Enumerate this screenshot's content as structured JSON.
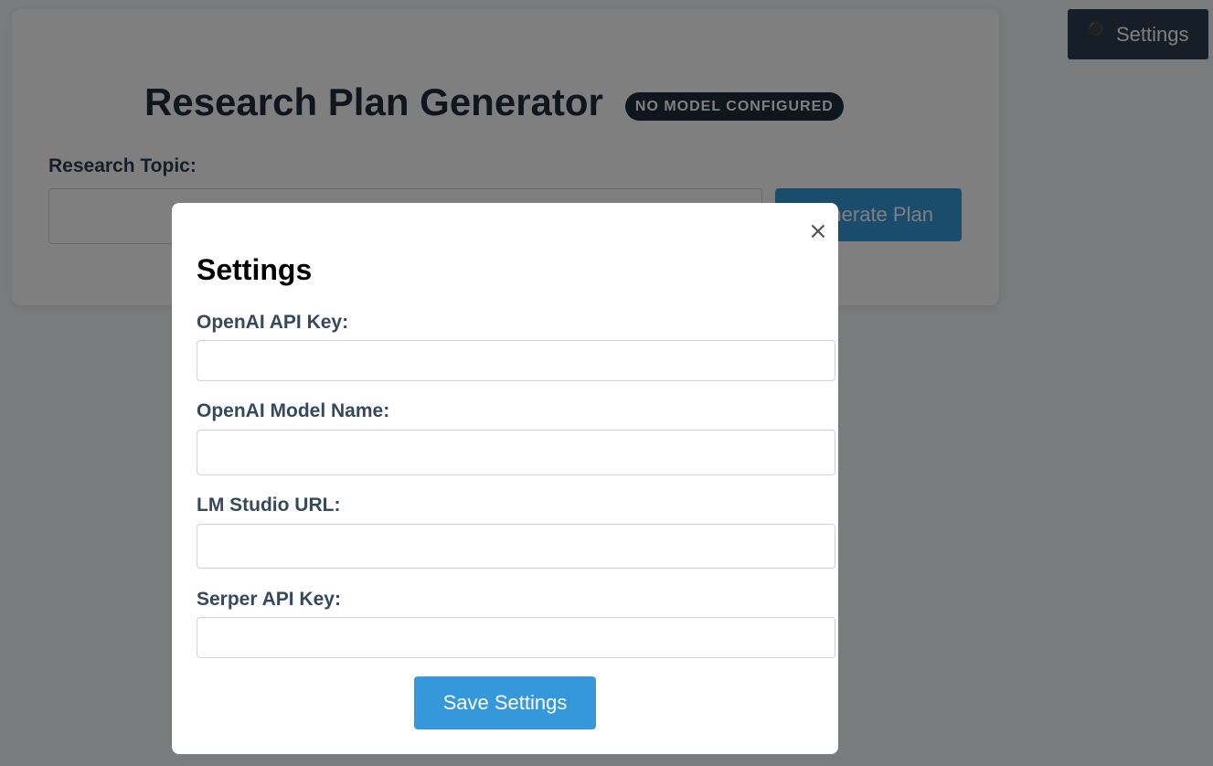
{
  "header": {
    "settings_button_label": "Settings",
    "settings_icon": "gear-icon"
  },
  "main": {
    "title": "Research Plan Generator",
    "model_status_badge": "NO MODEL CONFIGURED",
    "topic_label": "Research Topic:",
    "topic_value": "",
    "generate_button_label": "Generate Plan"
  },
  "settings_modal": {
    "title": "Settings",
    "close_label": "×",
    "fields": [
      {
        "label": "OpenAI API Key:",
        "value": ""
      },
      {
        "label": "OpenAI Model Name:",
        "value": ""
      },
      {
        "label": "LM Studio URL:",
        "value": ""
      },
      {
        "label": "Serper API Key:",
        "value": ""
      }
    ],
    "save_button_label": "Save Settings"
  },
  "colors": {
    "primary": "#3498db",
    "dark": "#2c3e50",
    "overlay": "rgba(0,0,0,0.5)"
  }
}
